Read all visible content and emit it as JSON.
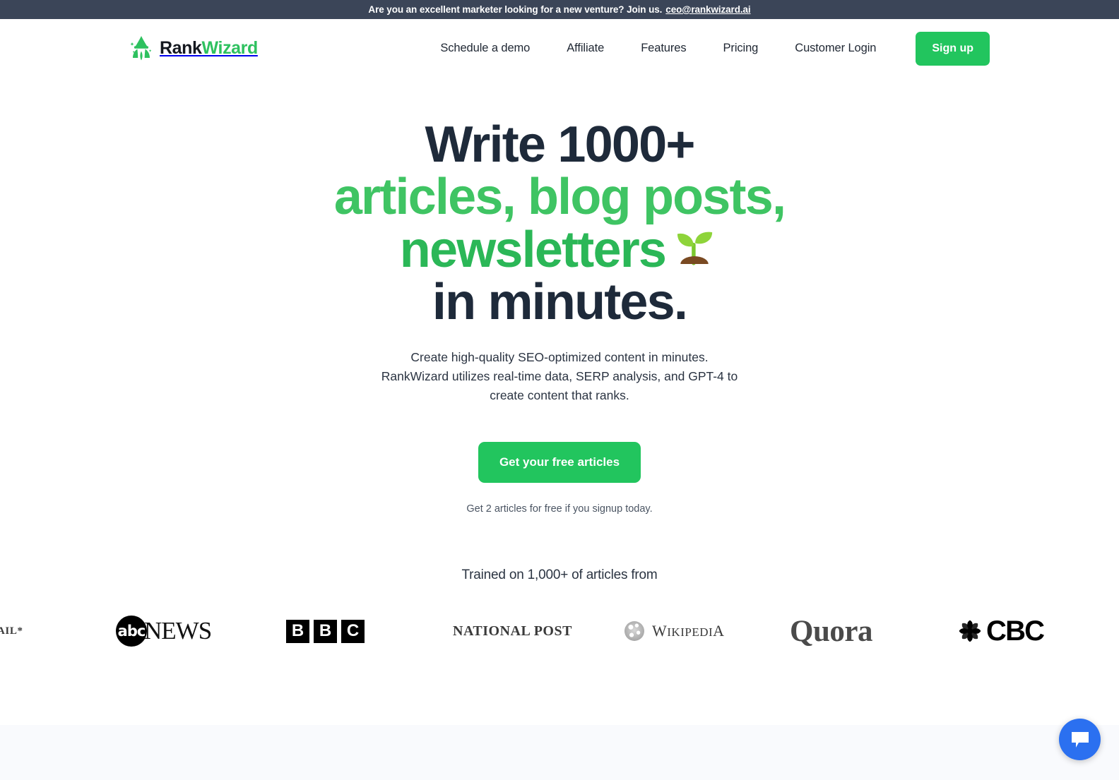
{
  "announcement": {
    "text": "Are you an excellent marketer looking for a new venture? Join us.",
    "link_label": "ceo@rankwizard.ai"
  },
  "header": {
    "brand": {
      "part1": "Rank",
      "part2": "Wizard",
      "icon": "wizard-logo-icon"
    },
    "nav": [
      {
        "label": "Schedule a demo"
      },
      {
        "label": "Affiliate"
      },
      {
        "label": "Features"
      },
      {
        "label": "Pricing"
      },
      {
        "label": "Customer Login"
      }
    ],
    "signup_label": "Sign up"
  },
  "hero": {
    "headline_line1": "Write 1000+",
    "headline_line2": "articles, blog posts,",
    "headline_line3": "newsletters",
    "headline_line4": "in minutes.",
    "headline_icon": "seedling-icon",
    "subhead_line1": "Create high-quality SEO-optimized content in minutes.",
    "subhead_line2": "RankWizard utilizes real-time data, SERP analysis, and GPT-4 to",
    "subhead_line3": "create content that ranks.",
    "cta_label": "Get your free articles",
    "cta_note": "Get 2 articles for free if you signup today."
  },
  "social_proof": {
    "heading": "Trained on 1,000+ of articles from",
    "logos": [
      {
        "name": "globe-and-mail-logo",
        "text": "ND MAIL*"
      },
      {
        "name": "abc-news-logo",
        "mark": "abc",
        "text": "NEWS"
      },
      {
        "name": "bbc-logo",
        "letters": [
          "B",
          "B",
          "C"
        ]
      },
      {
        "name": "national-post-logo",
        "text": "NATIONAL POST"
      },
      {
        "name": "wikipedia-logo",
        "text_large": "W",
        "text_small": "IKIPEDI",
        "text_tail": "A"
      },
      {
        "name": "quora-logo",
        "text": "Quora"
      },
      {
        "name": "cbc-logo",
        "text": "CBC"
      }
    ]
  },
  "chat_widget": {
    "icon": "chat-bubble-icon"
  },
  "colors": {
    "brand_green": "#22c55e",
    "headline_navy": "#1e2a3a",
    "announce_bg": "#3b4558",
    "chat_blue": "#2b70f0",
    "band_bg": "#f9fafd"
  }
}
